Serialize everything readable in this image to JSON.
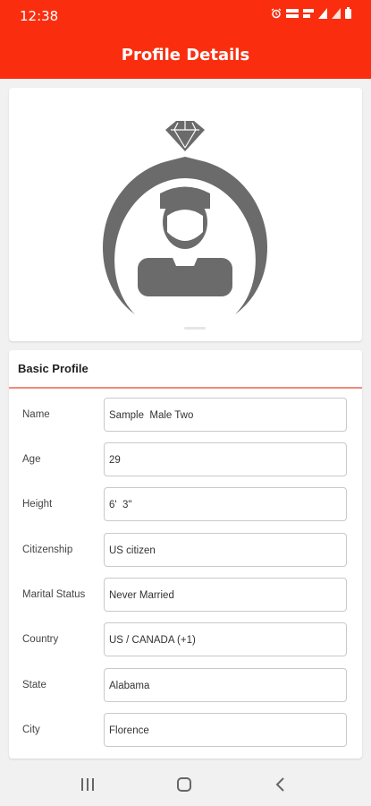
{
  "status_bar": {
    "time": "12:38",
    "icons": [
      "alarm-icon",
      "lte-icon",
      "volte-icon",
      "signal-icon",
      "signal-icon",
      "battery-icon"
    ]
  },
  "app_bar": {
    "title": "Profile Details"
  },
  "photo": {
    "icon": "ring-avatar-placeholder-icon"
  },
  "basic_profile": {
    "title": "Basic Profile",
    "fields": [
      {
        "label": "Name",
        "value": "Sample  Male Two"
      },
      {
        "label": "Age",
        "value": "29"
      },
      {
        "label": "Height",
        "value": "6'  3\""
      },
      {
        "label": "Citizenship",
        "value": "US citizen"
      },
      {
        "label": "Marital Status",
        "value": "Never Married"
      },
      {
        "label": "Country",
        "value": "US / CANADA (+1)"
      },
      {
        "label": "State",
        "value": "Alabama"
      },
      {
        "label": "City",
        "value": "Florence"
      }
    ]
  },
  "nav_bar": {
    "buttons": [
      "recent-apps-icon",
      "home-icon",
      "back-icon"
    ]
  },
  "colors": {
    "primary": "#fa2e0f",
    "underline": "#f08a7a",
    "background": "#f1f1f1",
    "icon_gray": "#6b6b6b"
  }
}
